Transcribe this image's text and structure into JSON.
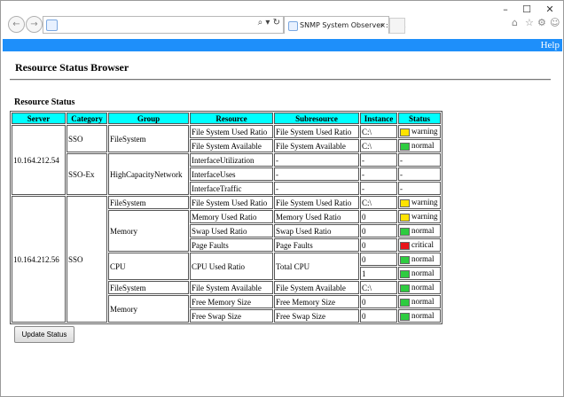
{
  "browser": {
    "tab_title": "SNMP System Observer : Re...",
    "tab_close": "×",
    "address_tools": "⌕ ▾ ↻",
    "window_controls": {
      "minimize": "–",
      "maximize": "☐",
      "close": "✕"
    }
  },
  "app": {
    "help_label": "Help",
    "title": "Resource Status Browser",
    "section_title": "Resource Status",
    "update_button": "Update Status",
    "header_color": "#1e8ffa",
    "table_header_color": "#00ffff"
  },
  "table": {
    "headers": [
      "Server",
      "Category",
      "Group",
      "Resource",
      "Subresource",
      "Instance",
      "Status"
    ],
    "server1": "10.164.212.54",
    "server2": "10.164.212.56",
    "cat_sso": "SSO",
    "cat_ssoex": "SSO-Ex",
    "cat_sso2": "SSO",
    "grp_fs1": "FileSystem",
    "grp_hcn": "HighCapacityNetwork",
    "grp_fs2": "FileSystem",
    "grp_mem1": "Memory",
    "grp_cpu": "CPU",
    "grp_fs3": "FileSystem",
    "grp_mem2": "Memory",
    "rows": [
      {
        "resource": "File System Used Ratio",
        "subresource": "File System Used Ratio",
        "instance": "C:\\",
        "status": "warning"
      },
      {
        "resource": "File System Available",
        "subresource": "File System Available",
        "instance": "C:\\",
        "status": "normal"
      },
      {
        "resource": "InterfaceUtilization",
        "subresource": "-",
        "instance": "-",
        "status": "-"
      },
      {
        "resource": "InterfaceUses",
        "subresource": "-",
        "instance": "-",
        "status": "-"
      },
      {
        "resource": "InterfaceTraffic",
        "subresource": "-",
        "instance": "-",
        "status": "-"
      },
      {
        "resource": "File System Used Ratio",
        "subresource": "File System Used Ratio",
        "instance": "C:\\",
        "status": "warning"
      },
      {
        "resource": "Memory Used Ratio",
        "subresource": "Memory Used Ratio",
        "instance": "0",
        "status": "warning"
      },
      {
        "resource": "Swap Used Ratio",
        "subresource": "Swap Used Ratio",
        "instance": "0",
        "status": "normal"
      },
      {
        "resource": "Page Faults",
        "subresource": "Page Faults",
        "instance": "0",
        "status": "critical"
      },
      {
        "resource": "CPU Used Ratio",
        "subresource": "Total CPU",
        "instance": "0",
        "status": "normal"
      },
      {
        "resource": "",
        "subresource": "",
        "instance": "1",
        "status": "normal"
      },
      {
        "resource": "File System Available",
        "subresource": "File System Available",
        "instance": "C:\\",
        "status": "normal"
      },
      {
        "resource": "Free Memory Size",
        "subresource": "Free Memory Size",
        "instance": "0",
        "status": "normal"
      },
      {
        "resource": "Free Swap Size",
        "subresource": "Free Swap Size",
        "instance": "0",
        "status": "normal"
      }
    ]
  }
}
